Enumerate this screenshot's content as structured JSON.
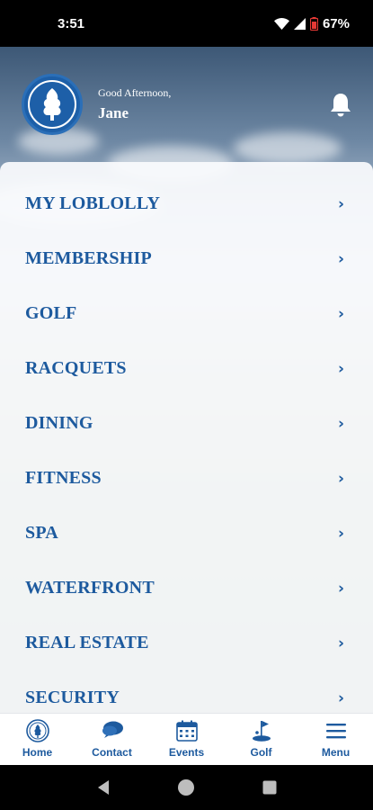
{
  "status_bar": {
    "time": "3:51",
    "battery": "67%"
  },
  "header": {
    "greeting": "Good Afternoon,",
    "user_name": "Jane"
  },
  "menu": {
    "items": [
      {
        "label": "MY LOBLOLLY"
      },
      {
        "label": "MEMBERSHIP"
      },
      {
        "label": "GOLF"
      },
      {
        "label": "RACQUETS"
      },
      {
        "label": "DINING"
      },
      {
        "label": "FITNESS"
      },
      {
        "label": "SPA"
      },
      {
        "label": "WATERFRONT"
      },
      {
        "label": "REAL ESTATE"
      },
      {
        "label": "SECURITY"
      }
    ],
    "chevron": "›"
  },
  "bottom_nav": {
    "items": [
      {
        "label": "Home",
        "icon": "club-logo-icon"
      },
      {
        "label": "Contact",
        "icon": "chat-bubbles-icon"
      },
      {
        "label": "Events",
        "icon": "calendar-icon"
      },
      {
        "label": "Golf",
        "icon": "golf-flag-icon"
      },
      {
        "label": "Menu",
        "icon": "hamburger-menu-icon"
      }
    ]
  },
  "colors": {
    "brand_blue": "#1d5a9e",
    "logo_blue": "#1d5fa8",
    "panel_bg": "#fafbfd"
  }
}
